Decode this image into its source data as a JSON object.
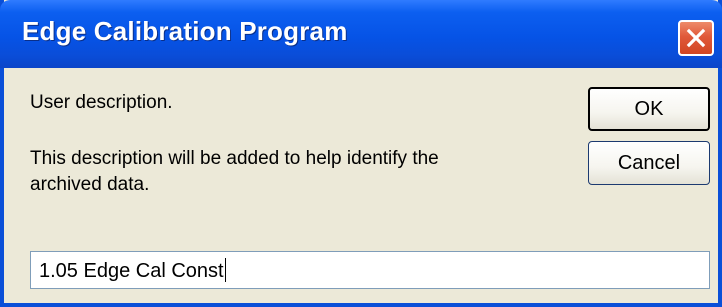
{
  "window": {
    "title": "Edge Calibration Program"
  },
  "dialog": {
    "prompt": "User description.",
    "help_line1": "This description will be added to help identify the",
    "help_line2": "archived data.",
    "description_value": "1.05 Edge Cal Const"
  },
  "buttons": {
    "ok_label": "OK",
    "cancel_label": "Cancel"
  },
  "icons": {
    "close": "close-icon"
  },
  "colors": {
    "titlebar": "#0653e6",
    "dialog_background": "#ece9d8",
    "close_button": "#e0593a"
  }
}
